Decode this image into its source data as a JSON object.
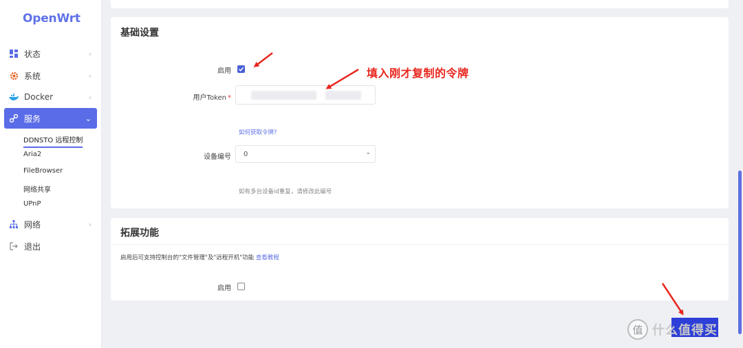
{
  "app": {
    "logo": "OpenWrt"
  },
  "sidebar": {
    "items": [
      {
        "label": "状态",
        "icon": "dashboard-icon",
        "chevron": "›"
      },
      {
        "label": "系统",
        "icon": "gear-icon",
        "chevron": "›"
      },
      {
        "label": "Docker",
        "icon": "docker-icon",
        "chevron": "›"
      },
      {
        "label": "服务",
        "icon": "services-icon",
        "chevron": "⌄"
      },
      {
        "label": "网络",
        "icon": "network-icon",
        "chevron": "›"
      },
      {
        "label": "退出",
        "icon": "logout-icon"
      }
    ],
    "sub_items": [
      {
        "label": "DDNSTO 远程控制"
      },
      {
        "label": "Aria2"
      },
      {
        "label": "FileBrowser"
      },
      {
        "label": "网络共享"
      },
      {
        "label": "UPnP"
      }
    ],
    "accent": "#5b6ce8"
  },
  "basic": {
    "title": "基础设置",
    "enable_label": "启用",
    "enable_checked": true,
    "token_label": "用户Token",
    "token_required": "*",
    "token_help": "如何获取令牌?",
    "device_label": "设备编号",
    "device_value": "0",
    "device_hint": "如有多台设备id重复，请修改此编号"
  },
  "extension": {
    "title": "拓展功能",
    "desc": "启用后可支持控制台的\"文件管理\"及\"远程开机\"功能",
    "tutorial_link": "查看教程",
    "enable_label": "启用",
    "enable_checked": false
  },
  "annotation": {
    "text": "填入刚才复制的令牌",
    "color": "#e8261e"
  },
  "watermark": {
    "text": "什么值得买",
    "logo": "值"
  }
}
